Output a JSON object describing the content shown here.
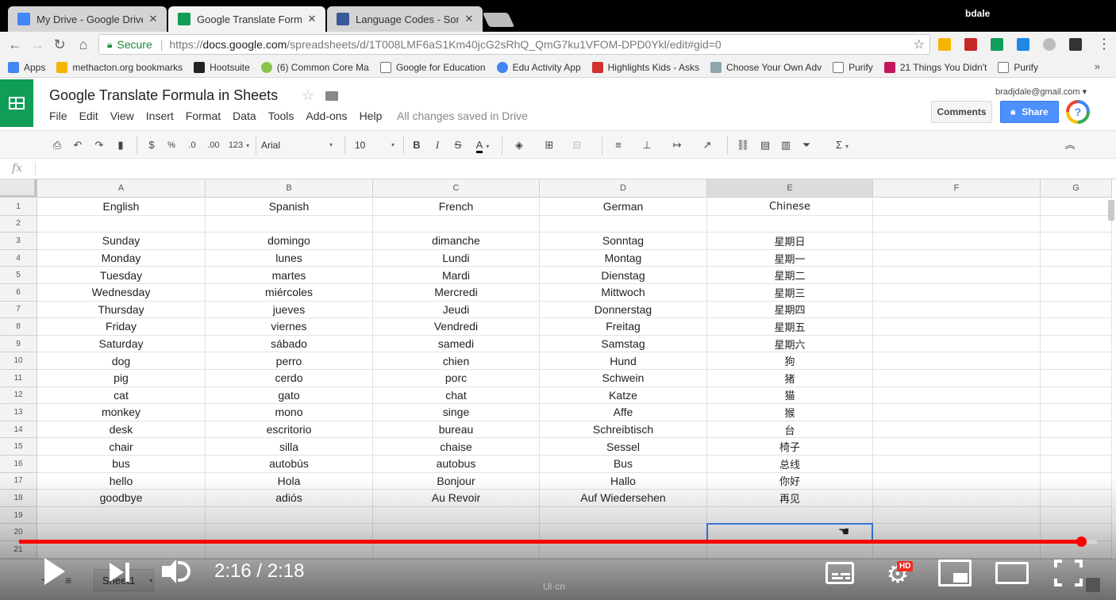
{
  "browser": {
    "tabs": [
      {
        "label": "My Drive - Google Drive",
        "color": "#4285f4"
      },
      {
        "label": "Google Translate Formul",
        "color": "#0f9d58",
        "active": true
      },
      {
        "label": "Language Codes - Sortal",
        "color": "#3b5998"
      }
    ],
    "profile_name": "bdale",
    "address": {
      "secure_label": "Secure",
      "url_proto": "https://",
      "url_host": "docs.google.com",
      "url_path": "/spreadsheets/d/1T008LMF6aS1Km40jcG2sRhQ_QmG7ku1VFOM-DPD0Ykl/edit#gid=0"
    },
    "bookmarks": [
      {
        "label": "Apps",
        "color": "#4285f4"
      },
      {
        "label": "methacton.org bookmarks",
        "color": "#f4b400"
      },
      {
        "label": "Hootsuite",
        "color": "#222222"
      },
      {
        "label": "(6) Common Core Ma",
        "color": "#8bc34a"
      },
      {
        "label": "Google for Education",
        "color": "#dddddd"
      },
      {
        "label": "Edu Activity App",
        "color": "#4285f4"
      },
      {
        "label": "Highlights Kids - Asks",
        "color": "#d32f2f"
      },
      {
        "label": "Choose Your Own Adv",
        "color": "#90a4ae"
      },
      {
        "label": "Purify",
        "color": "#dddddd"
      },
      {
        "label": "21 Things You Didn't",
        "color": "#c2185b"
      },
      {
        "label": "Purify",
        "color": "#dddddd"
      }
    ],
    "bookmarks_more": "»"
  },
  "sheets": {
    "title": "Google Translate Formula in Sheets",
    "menu": [
      "File",
      "Edit",
      "View",
      "Insert",
      "Format",
      "Data",
      "Tools",
      "Add-ons",
      "Help"
    ],
    "saved_status": "All changes saved in Drive",
    "account_email": "bradjdale@gmail.com",
    "comments_label": "Comments",
    "share_label": "Share",
    "toolbar": {
      "currency": "$",
      "percent": "%",
      "decrease_decimals": ".0",
      "increase_decimals": ".00",
      "more_formats": "123",
      "font": "Arial",
      "font_size": "10",
      "bold": "B",
      "italic": "I",
      "strike": "S",
      "text_color": "A",
      "functions": "Σ"
    },
    "fx_label": "fx",
    "columns": [
      "A",
      "B",
      "C",
      "D",
      "E",
      "F",
      "G"
    ],
    "selected_column": "E",
    "rows": [
      [
        "English",
        "Spanish",
        "French",
        "German",
        "Chinese"
      ],
      [
        "",
        "",
        "",
        "",
        ""
      ],
      [
        "Sunday",
        "domingo",
        "dimanche",
        "Sonntag",
        "星期日"
      ],
      [
        "Monday",
        "lunes",
        "Lundi",
        "Montag",
        "星期一"
      ],
      [
        "Tuesday",
        "martes",
        "Mardi",
        "Dienstag",
        "星期二"
      ],
      [
        "Wednesday",
        "miércoles",
        "Mercredi",
        "Mittwoch",
        "星期三"
      ],
      [
        "Thursday",
        "jueves",
        "Jeudi",
        "Donnerstag",
        "星期四"
      ],
      [
        "Friday",
        "viernes",
        "Vendredi",
        "Freitag",
        "星期五"
      ],
      [
        "Saturday",
        "sábado",
        "samedi",
        "Samstag",
        "星期六"
      ],
      [
        "dog",
        "perro",
        "chien",
        "Hund",
        "狗"
      ],
      [
        "pig",
        "cerdo",
        "porc",
        "Schwein",
        "猪"
      ],
      [
        "cat",
        "gato",
        "chat",
        "Katze",
        "猫"
      ],
      [
        "monkey",
        "mono",
        "singe",
        "Affe",
        "猴"
      ],
      [
        "desk",
        "escritorio",
        "bureau",
        "Schreibtisch",
        "台"
      ],
      [
        "chair",
        "silla",
        "chaise",
        "Sessel",
        "椅子"
      ],
      [
        "bus",
        "autobús",
        "autobus",
        "Bus",
        "总线"
      ],
      [
        "hello",
        "Hola",
        "Bonjour",
        "Hallo",
        "你好"
      ],
      [
        "goodbye",
        "adiós",
        "Au Revoir",
        "Auf Wiedersehen",
        "再见"
      ],
      [
        "",
        "",
        "",
        "",
        ""
      ],
      [
        "",
        "",
        "",
        "",
        ""
      ],
      [
        "",
        "",
        "",
        "",
        ""
      ]
    ],
    "active_cell": "E20",
    "sheet_tab_label": "Sheet1"
  },
  "player": {
    "time_current": "2:16",
    "time_total": "2:18",
    "time_display": "2:16 / 2:18",
    "progress_fraction": 0.985,
    "hd_label": "HD",
    "watermark": "Ul·cn"
  },
  "colors": {
    "sheets_green": "#0f9d58",
    "share_blue": "#4d90fe",
    "progress_red": "#ff0000",
    "selection_blue": "#4285f4"
  }
}
